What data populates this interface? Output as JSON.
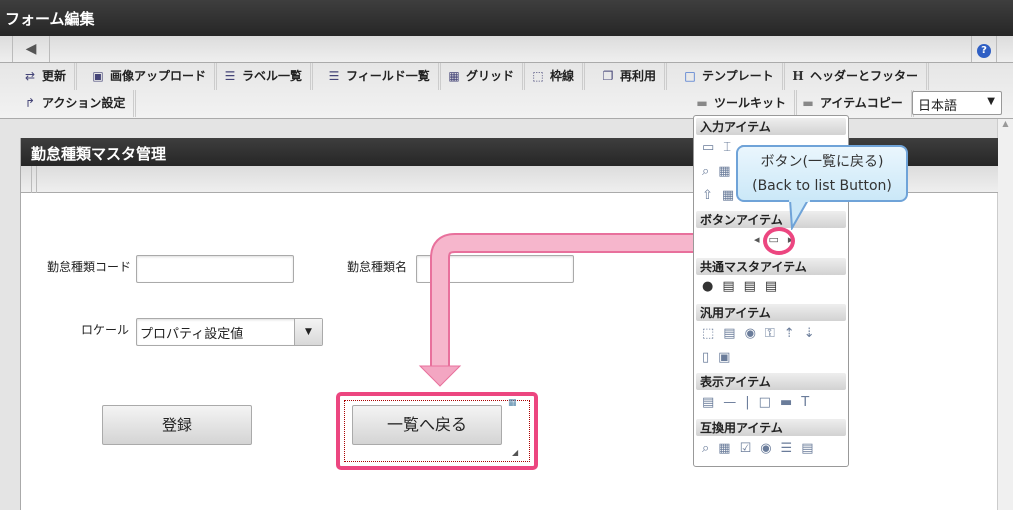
{
  "window": {
    "title": "フォーム編集"
  },
  "nav": {
    "back_icon": "arrow-left-icon",
    "help_icon": "help-icon"
  },
  "tabs": [
    {
      "label": "更新",
      "icon": "update-icon"
    },
    {
      "label": "画像アップロード",
      "icon": "image-upload-icon"
    },
    {
      "label": "ラベル一覧",
      "icon": "list-icon"
    },
    {
      "label": "フィールド一覧",
      "icon": "list-icon"
    },
    {
      "label": "グリッド",
      "icon": "grid-icon"
    },
    {
      "label": "枠線",
      "icon": "border-icon"
    },
    {
      "label": "再利用",
      "icon": "copy-icon"
    },
    {
      "label": "テンプレート",
      "icon": "template-icon"
    },
    {
      "label": "ヘッダーとフッター",
      "icon": "header-icon"
    },
    {
      "label": "アクション設定",
      "icon": "action-icon"
    },
    {
      "label": "ツールキット",
      "icon": "toolbox-icon"
    },
    {
      "label": "アイテムコピー",
      "icon": "toolbox-icon"
    }
  ],
  "language": {
    "selected": "日本語"
  },
  "panel": {
    "title": "勤怠種類マスタ管理"
  },
  "form": {
    "code_label": "勤怠種類コード",
    "code_value": "",
    "name_label": "勤怠種類名",
    "name_value": "",
    "locale_label": "ロケール",
    "locale_value": "プロパティ設定値",
    "register_button": "登録",
    "back_button": "一覧へ戻る"
  },
  "toolkit": {
    "sections": [
      "入力アイテム",
      "ボタンアイテム",
      "共通マスタアイテム",
      "汎用アイテム",
      "表示アイテム",
      "互換用アイテム"
    ]
  },
  "callout": {
    "line1": "ボタン(一覧に戻る)",
    "line2": "(Back to list Button)"
  },
  "colors": {
    "highlight": "#ec4680",
    "callout_border": "#6fa3d8"
  }
}
